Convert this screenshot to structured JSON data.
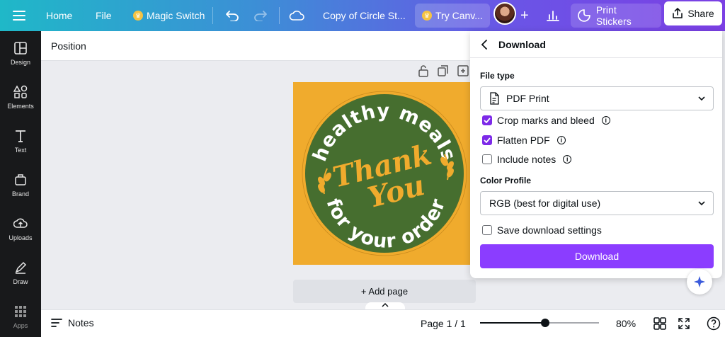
{
  "topbar": {
    "home": "Home",
    "file": "File",
    "magic_switch": "Magic Switch",
    "doc_title": "Copy of Circle St...",
    "try_canva": "Try Canv...",
    "print_stickers": "Print Stickers",
    "share": "Share"
  },
  "sidebar": {
    "items": [
      {
        "label": "Design",
        "icon": "design-icon"
      },
      {
        "label": "Elements",
        "icon": "elements-icon"
      },
      {
        "label": "Text",
        "icon": "text-icon"
      },
      {
        "label": "Brand",
        "icon": "brand-icon"
      },
      {
        "label": "Uploads",
        "icon": "uploads-icon"
      },
      {
        "label": "Draw",
        "icon": "draw-icon"
      },
      {
        "label": "Apps",
        "icon": "apps-icon"
      }
    ]
  },
  "toolbar": {
    "position": "Position"
  },
  "design": {
    "top_text": "healthy meals",
    "script_line1": "Thank",
    "script_line2": "You",
    "bottom_text": "for your order",
    "colors": {
      "background": "#f0ab2d",
      "circle": "#466e2f",
      "text": "#ffffff",
      "script": "#f0ab2d"
    }
  },
  "canvas": {
    "add_page": "+ Add page"
  },
  "bottombar": {
    "notes": "Notes",
    "page": "Page 1 / 1",
    "zoom": "80%",
    "zoom_level": 0.55
  },
  "download_panel": {
    "title": "Download",
    "file_type_label": "File type",
    "file_type_value": "PDF Print",
    "options": [
      {
        "label": "Crop marks and bleed",
        "checked": true,
        "info": true
      },
      {
        "label": "Flatten PDF",
        "checked": true,
        "info": true
      },
      {
        "label": "Include notes",
        "checked": false,
        "info": true
      }
    ],
    "color_profile_label": "Color Profile",
    "color_profile_value": "RGB (best for digital use)",
    "save_settings": "Save download settings",
    "download_button": "Download",
    "accent": "#8b3dff"
  }
}
